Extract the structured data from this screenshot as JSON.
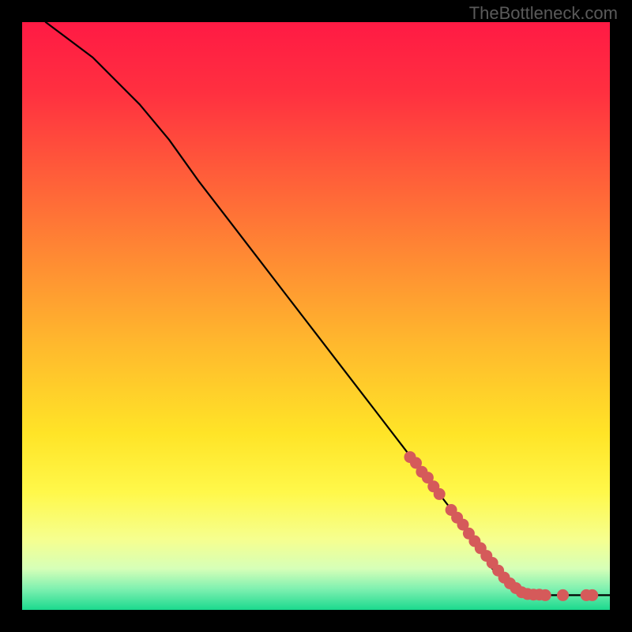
{
  "watermark": "TheBottleneck.com",
  "chart_data": {
    "type": "line",
    "title": "",
    "xlabel": "",
    "ylabel": "",
    "xlim": [
      0,
      100
    ],
    "ylim": [
      0,
      100
    ],
    "series": [
      {
        "name": "curve",
        "x": [
          4,
          8,
          12,
          16,
          20,
          25,
          30,
          35,
          40,
          45,
          50,
          55,
          60,
          65,
          70,
          75,
          78,
          80,
          82,
          85,
          90,
          95,
          100
        ],
        "y": [
          100,
          97,
          94,
          90,
          86,
          80,
          73,
          66.5,
          60,
          53.5,
          47,
          40.5,
          34,
          27.5,
          21,
          14.5,
          10,
          7,
          5,
          3,
          2.5,
          2.5,
          2.5
        ]
      }
    ],
    "highlight_points": {
      "name": "highlighted-dots",
      "color": "#d55a5a",
      "points": [
        {
          "x": 66,
          "y": 26
        },
        {
          "x": 67,
          "y": 25
        },
        {
          "x": 68,
          "y": 23.5
        },
        {
          "x": 69,
          "y": 22.5
        },
        {
          "x": 70,
          "y": 21
        },
        {
          "x": 71,
          "y": 19.7
        },
        {
          "x": 73,
          "y": 17
        },
        {
          "x": 74,
          "y": 15.7
        },
        {
          "x": 75,
          "y": 14.5
        },
        {
          "x": 76,
          "y": 13
        },
        {
          "x": 77,
          "y": 11.7
        },
        {
          "x": 78,
          "y": 10.5
        },
        {
          "x": 79,
          "y": 9.2
        },
        {
          "x": 80,
          "y": 8
        },
        {
          "x": 81,
          "y": 6.7
        },
        {
          "x": 82,
          "y": 5.5
        },
        {
          "x": 83,
          "y": 4.5
        },
        {
          "x": 84,
          "y": 3.7
        },
        {
          "x": 85,
          "y": 3
        },
        {
          "x": 86,
          "y": 2.7
        },
        {
          "x": 87,
          "y": 2.6
        },
        {
          "x": 88,
          "y": 2.6
        },
        {
          "x": 89,
          "y": 2.5
        },
        {
          "x": 92,
          "y": 2.5
        },
        {
          "x": 96,
          "y": 2.5
        },
        {
          "x": 97,
          "y": 2.5
        }
      ]
    },
    "gradient_stops": [
      {
        "offset": 0.0,
        "color": "#ff1a44"
      },
      {
        "offset": 0.12,
        "color": "#ff3040"
      },
      {
        "offset": 0.25,
        "color": "#ff5a3a"
      },
      {
        "offset": 0.4,
        "color": "#ff8a33"
      },
      {
        "offset": 0.55,
        "color": "#ffb92d"
      },
      {
        "offset": 0.7,
        "color": "#ffe427"
      },
      {
        "offset": 0.8,
        "color": "#fff84a"
      },
      {
        "offset": 0.88,
        "color": "#f6ff8f"
      },
      {
        "offset": 0.93,
        "color": "#d6ffb8"
      },
      {
        "offset": 0.965,
        "color": "#7df0b0"
      },
      {
        "offset": 1.0,
        "color": "#1bd98e"
      }
    ]
  }
}
